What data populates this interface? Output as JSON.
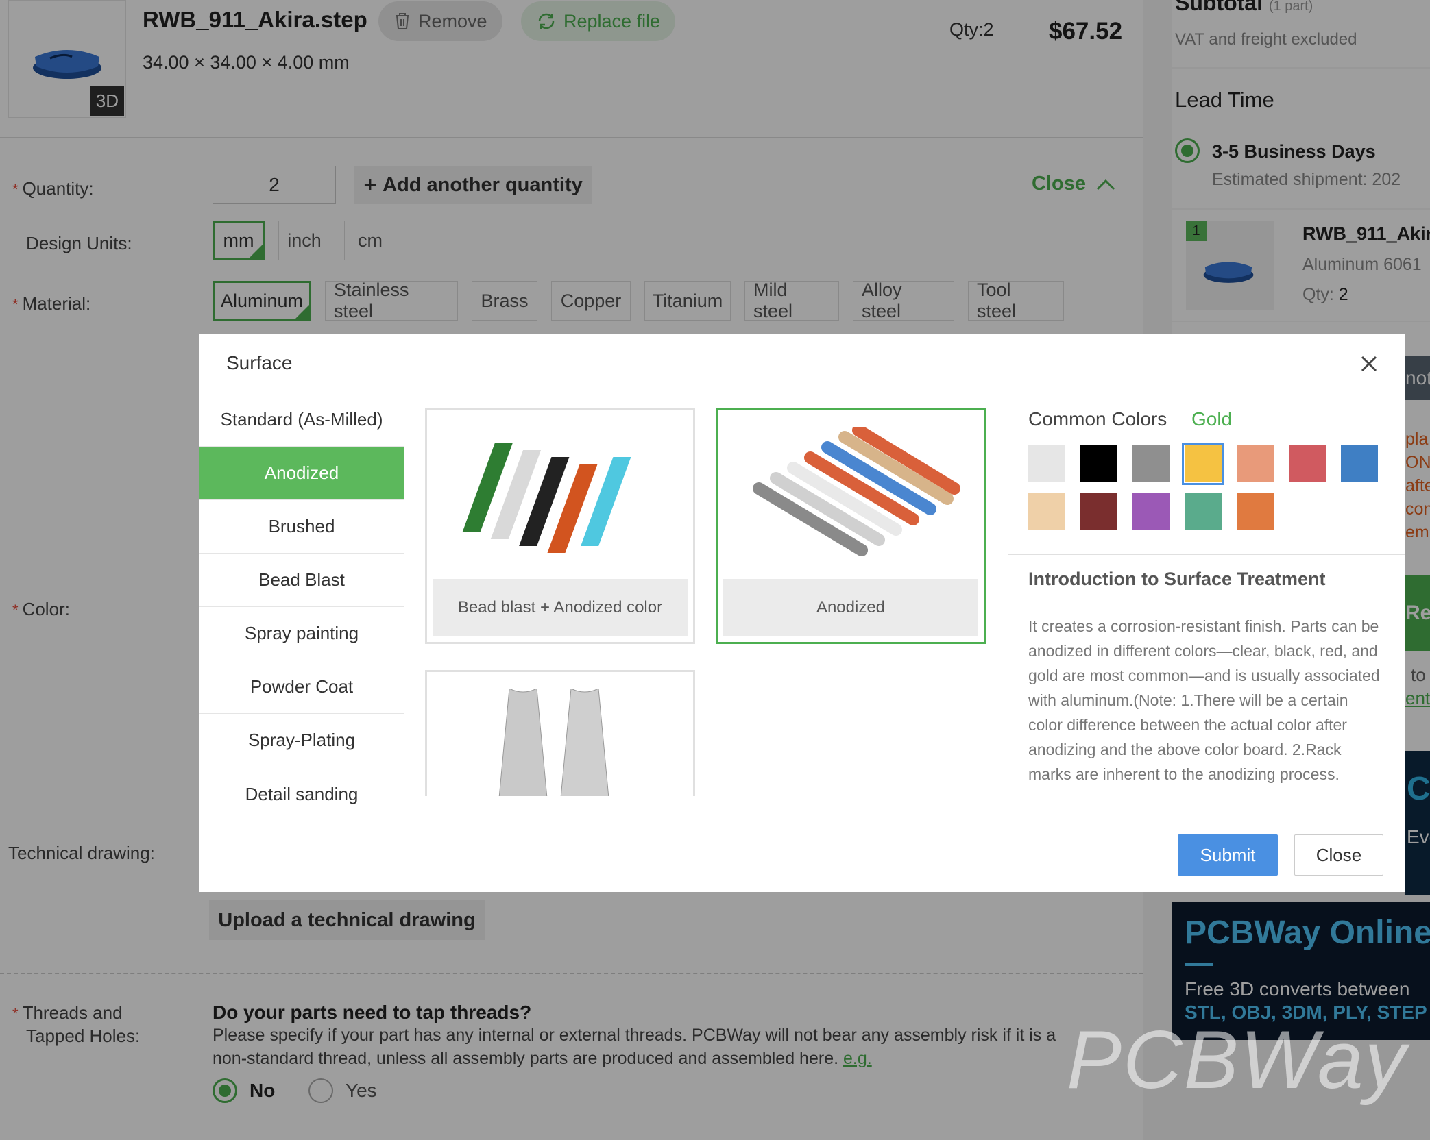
{
  "part": {
    "filename": "RWB_911_Akira.step",
    "dimensions": "34.00 × 34.00 × 4.00 mm",
    "badge_3d": "3D",
    "remove_label": "Remove",
    "replace_label": "Replace file",
    "qty_label": "Qty:2",
    "price": "$67.52"
  },
  "form": {
    "quantity_label": "Quantity:",
    "quantity_value": "2",
    "add_quantity_label": "Add another quantity",
    "close_label": "Close",
    "design_units_label": "Design Units:",
    "units": [
      {
        "label": "mm",
        "selected": true
      },
      {
        "label": "inch",
        "selected": false
      },
      {
        "label": "cm",
        "selected": false
      }
    ],
    "material_label": "Material:",
    "materials": [
      {
        "label": "Aluminum",
        "selected": true
      },
      {
        "label": "Stainless steel",
        "selected": false
      },
      {
        "label": "Brass",
        "selected": false
      },
      {
        "label": "Copper",
        "selected": false
      },
      {
        "label": "Titanium",
        "selected": false
      },
      {
        "label": "Mild steel",
        "selected": false
      },
      {
        "label": "Alloy steel",
        "selected": false
      },
      {
        "label": "Tool steel",
        "selected": false
      }
    ],
    "color_label": "Color:",
    "tech_drawing_label": "Technical drawing:",
    "upload_drawing_label": "Upload a technical drawing",
    "threads_label_1": "Threads and",
    "threads_label_2": "Tapped Holes:",
    "threads_question": "Do your parts need to tap threads?",
    "threads_desc": "Please specify if your part has any internal or external threads. PCBWay will not bear any assembly risk if it is a non-standard thread, unless all assembly parts are produced and assembled here.",
    "threads_eg": "e.g.",
    "threads_no": "No",
    "threads_yes": "Yes"
  },
  "sidebar": {
    "subtotal_title": "Subtotal",
    "subtotal_sub": "(1 part)",
    "vat_note": "VAT and freight excluded",
    "lead_time_title": "Lead Time",
    "lead_option": "3-5 Business Days",
    "est_shipment": "Estimated shipment: 202",
    "item_number": "1",
    "item_name": "RWB_911_Akir",
    "item_material": "Aluminum 6061",
    "item_qty_label": "Qty:",
    "item_qty_value": "2",
    "peek_text_1": "not",
    "peek_lines": [
      "pla",
      "ON",
      "afte",
      "con",
      "em"
    ],
    "peek_green": "Rec",
    "peek_to": "to",
    "peek_link": "ent",
    "peek_dark_c": "C",
    "peek_dark_eve": "Eve",
    "banner_title": "PCBWay Online",
    "banner_line1": "Free 3D converts between",
    "banner_line2": "STL, OBJ, 3DM, PLY, STEP",
    "watermark": "PCBWay"
  },
  "modal": {
    "title": "Surface",
    "tabs": [
      {
        "label": "Standard (As-Milled)",
        "active": false
      },
      {
        "label": "Anodized",
        "active": true
      },
      {
        "label": "Brushed",
        "active": false
      },
      {
        "label": "Bead Blast",
        "active": false
      },
      {
        "label": "Spray painting",
        "active": false
      },
      {
        "label": "Powder Coat",
        "active": false
      },
      {
        "label": "Spray-Plating",
        "active": false
      },
      {
        "label": "Detail sanding",
        "active": false
      }
    ],
    "cards": [
      {
        "label": "Bead blast + Anodized color",
        "selected": false
      },
      {
        "label": "Anodized",
        "selected": true
      },
      {
        "label": "",
        "selected": false
      }
    ],
    "common_colors_label": "Common Colors",
    "selected_color": "Gold",
    "swatches": [
      "#e6e6e6",
      "#000000",
      "#8f8f8f",
      "#f5c242",
      "#e89a7a",
      "#d05a60",
      "#3f7fc4",
      "#efd0a8",
      "#7a2e2e",
      "#9b59b6",
      "#5aab8c",
      "#e07a40"
    ],
    "selected_swatch_index": 3,
    "intro_title": "Introduction to Surface Treatment",
    "intro_text": "It creates a corrosion-resistant finish. Parts can be anodized in different colors—clear, black, red, and gold are most common—and is usually associated with aluminum.(Note: 1.There will be a certain color difference between the actual color after anodizing and the above color board. 2.Rack marks are inherent to the anodizing process. When engineering a part that will be",
    "submit_label": "Submit",
    "close_label": "Close"
  },
  "colors": {
    "accent_green": "#4caf50",
    "tab_green": "#5cb85c",
    "submit_blue": "#4a90e2"
  }
}
